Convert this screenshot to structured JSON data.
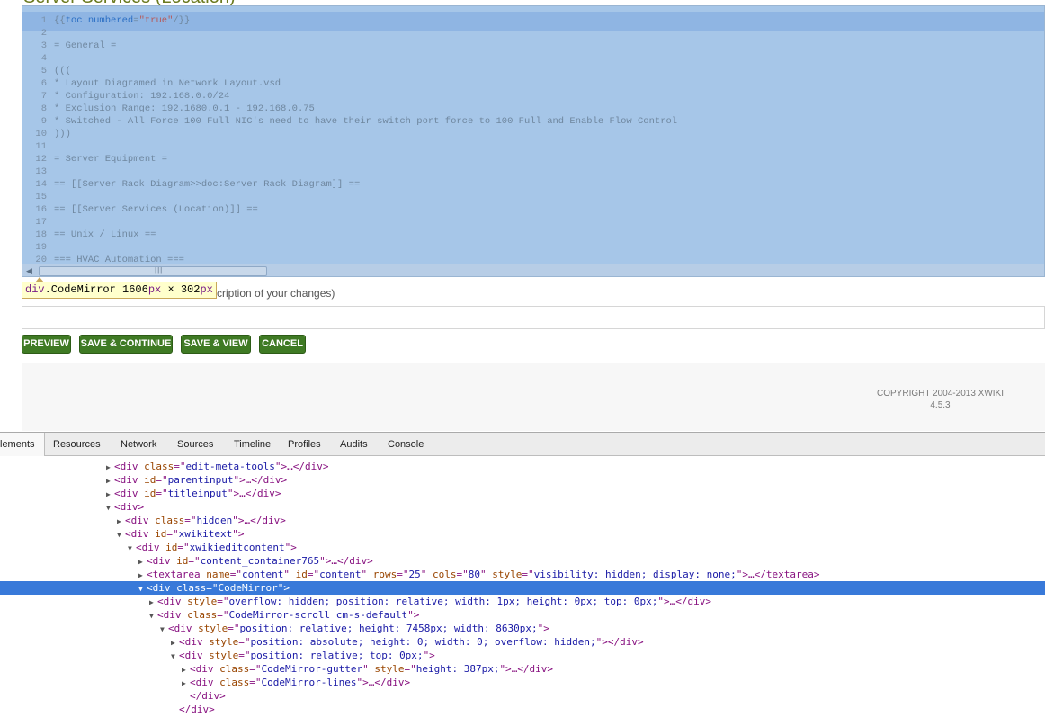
{
  "page": {
    "title": "Server Services (Location)"
  },
  "editor": {
    "lines": [
      {
        "n": "1",
        "text": "{{toc numbered=\"true\"/}}"
      },
      {
        "n": "2",
        "text": ""
      },
      {
        "n": "3",
        "text": "= General ="
      },
      {
        "n": "4",
        "text": ""
      },
      {
        "n": "5",
        "text": "((("
      },
      {
        "n": "6",
        "text": "* Layout Diagramed in Network Layout.vsd"
      },
      {
        "n": "7",
        "text": "* Configuration: 192.168.0.0/24"
      },
      {
        "n": "8",
        "text": "* Exclusion Range: 192.1680.0.1 - 192.168.0.75"
      },
      {
        "n": "9",
        "text": "* Switched - All Force 100 Full NIC's need to have their switch port force to 100 Full and Enable Flow Control"
      },
      {
        "n": "10",
        "text": ")))"
      },
      {
        "n": "11",
        "text": ""
      },
      {
        "n": "12",
        "text": "= Server Equipment ="
      },
      {
        "n": "13",
        "text": ""
      },
      {
        "n": "14",
        "text": "== [[Server Rack Diagram>>doc:Server Rack Diagram]] =="
      },
      {
        "n": "15",
        "text": ""
      },
      {
        "n": "16",
        "text": "== [[Server Services (Location)]] =="
      },
      {
        "n": "17",
        "text": ""
      },
      {
        "n": "18",
        "text": "== Unix / Linux =="
      },
      {
        "n": "19",
        "text": ""
      },
      {
        "n": "20",
        "text": "=== HVAC Automation ==="
      }
    ],
    "first_line": {
      "open": "{{",
      "macro": "toc",
      "param": "numbered",
      "eq": "=",
      "value": "\"true\"",
      "close": "/}}"
    }
  },
  "inspector_tip": {
    "tag": "div",
    "cls": ".CodeMirror",
    "w": "1606",
    "unit1": "px",
    "x": " × ",
    "h": "302",
    "unit2": "px"
  },
  "summary": {
    "label": "cription of your changes)",
    "value": ""
  },
  "buttons": {
    "preview": "PREVIEW",
    "save_continue": "SAVE & CONTINUE",
    "save_view": "SAVE & VIEW",
    "cancel": "CANCEL"
  },
  "footer": {
    "line1": "COPYRIGHT 2004-2013 XWIKI",
    "line2": "4.5.3"
  },
  "devtools": {
    "tabs": {
      "elements": "lements",
      "resources": "Resources",
      "network": "Network",
      "sources": "Sources",
      "timeline": "Timeline",
      "profiles": "Profiles",
      "audits": "Audits",
      "console": "Console"
    },
    "nodes": [
      {
        "pad": 118,
        "tw": "▶",
        "parts": [
          [
            "t",
            "<div "
          ],
          [
            "a",
            "class"
          ],
          [
            "t",
            "=\""
          ],
          [
            "v",
            "edit-meta-tools"
          ],
          [
            "t",
            "\">"
          ],
          [
            "p",
            "…"
          ],
          [
            "t",
            "</div>"
          ]
        ]
      },
      {
        "pad": 118,
        "tw": "▶",
        "parts": [
          [
            "t",
            "<div "
          ],
          [
            "a",
            "id"
          ],
          [
            "t",
            "=\""
          ],
          [
            "v",
            "parentinput"
          ],
          [
            "t",
            "\">"
          ],
          [
            "p",
            "…"
          ],
          [
            "t",
            "</div>"
          ]
        ]
      },
      {
        "pad": 118,
        "tw": "▶",
        "parts": [
          [
            "t",
            "<div "
          ],
          [
            "a",
            "id"
          ],
          [
            "t",
            "=\""
          ],
          [
            "v",
            "titleinput"
          ],
          [
            "t",
            "\">"
          ],
          [
            "p",
            "…"
          ],
          [
            "t",
            "</div>"
          ]
        ]
      },
      {
        "pad": 118,
        "tw": "▼",
        "parts": [
          [
            "t",
            "<div>"
          ]
        ]
      },
      {
        "pad": 130,
        "tw": "▶",
        "parts": [
          [
            "t",
            "<div "
          ],
          [
            "a",
            "class"
          ],
          [
            "t",
            "=\""
          ],
          [
            "v",
            "hidden"
          ],
          [
            "t",
            "\">"
          ],
          [
            "p",
            "…"
          ],
          [
            "t",
            "</div>"
          ]
        ]
      },
      {
        "pad": 130,
        "tw": "▼",
        "parts": [
          [
            "t",
            "<div "
          ],
          [
            "a",
            "id"
          ],
          [
            "t",
            "=\""
          ],
          [
            "v",
            "xwikitext"
          ],
          [
            "t",
            "\">"
          ]
        ]
      },
      {
        "pad": 142,
        "tw": "▼",
        "parts": [
          [
            "t",
            "<div "
          ],
          [
            "a",
            "id"
          ],
          [
            "t",
            "=\""
          ],
          [
            "v",
            "xwikieditcontent"
          ],
          [
            "t",
            "\">"
          ]
        ]
      },
      {
        "pad": 154,
        "tw": "▶",
        "parts": [
          [
            "t",
            "<div "
          ],
          [
            "a",
            "id"
          ],
          [
            "t",
            "=\""
          ],
          [
            "v",
            "content_container765"
          ],
          [
            "t",
            "\">"
          ],
          [
            "p",
            "…"
          ],
          [
            "t",
            "</div>"
          ]
        ]
      },
      {
        "pad": 154,
        "tw": "▶",
        "parts": [
          [
            "t",
            "<textarea "
          ],
          [
            "a",
            "name"
          ],
          [
            "t",
            "=\""
          ],
          [
            "v",
            "content"
          ],
          [
            "t",
            "\" "
          ],
          [
            "a",
            "id"
          ],
          [
            "t",
            "=\""
          ],
          [
            "v",
            "content"
          ],
          [
            "t",
            "\" "
          ],
          [
            "a",
            "rows"
          ],
          [
            "t",
            "=\""
          ],
          [
            "v",
            "25"
          ],
          [
            "t",
            "\" "
          ],
          [
            "a",
            "cols"
          ],
          [
            "t",
            "=\""
          ],
          [
            "v",
            "80"
          ],
          [
            "t",
            "\" "
          ],
          [
            "a",
            "style"
          ],
          [
            "t",
            "=\""
          ],
          [
            "v",
            "visibility: hidden; display: none;"
          ],
          [
            "t",
            "\">"
          ],
          [
            "p",
            "…"
          ],
          [
            "t",
            "</textarea>"
          ]
        ]
      },
      {
        "pad": 154,
        "tw": "▼",
        "sel": true,
        "parts": [
          [
            "t",
            "<div "
          ],
          [
            "a",
            "class"
          ],
          [
            "t",
            "=\""
          ],
          [
            "v",
            "CodeMirror"
          ],
          [
            "t",
            "\">"
          ]
        ]
      },
      {
        "pad": 166,
        "tw": "▶",
        "parts": [
          [
            "t",
            "<div "
          ],
          [
            "a",
            "style"
          ],
          [
            "t",
            "=\""
          ],
          [
            "v",
            "overflow: hidden; position: relative; width: 1px; height: 0px; top: 0px;"
          ],
          [
            "t",
            "\">"
          ],
          [
            "p",
            "…"
          ],
          [
            "t",
            "</div>"
          ]
        ]
      },
      {
        "pad": 166,
        "tw": "▼",
        "parts": [
          [
            "t",
            "<div "
          ],
          [
            "a",
            "class"
          ],
          [
            "t",
            "=\""
          ],
          [
            "v",
            "CodeMirror-scroll cm-s-default"
          ],
          [
            "t",
            "\">"
          ]
        ]
      },
      {
        "pad": 178,
        "tw": "▼",
        "parts": [
          [
            "t",
            "<div "
          ],
          [
            "a",
            "style"
          ],
          [
            "t",
            "=\""
          ],
          [
            "v",
            "position: relative; height: 7458px; width: 8630px;"
          ],
          [
            "t",
            "\">"
          ]
        ]
      },
      {
        "pad": 190,
        "tw": "▶",
        "parts": [
          [
            "t",
            "<div "
          ],
          [
            "a",
            "style"
          ],
          [
            "t",
            "=\""
          ],
          [
            "v",
            "position: absolute; height: 0; width: 0; overflow: hidden;"
          ],
          [
            "t",
            "\">"
          ],
          [
            "t",
            "</div>"
          ]
        ]
      },
      {
        "pad": 190,
        "tw": "▼",
        "parts": [
          [
            "t",
            "<div "
          ],
          [
            "a",
            "style"
          ],
          [
            "t",
            "=\""
          ],
          [
            "v",
            "position: relative; top: 0px;"
          ],
          [
            "t",
            "\">"
          ]
        ]
      },
      {
        "pad": 202,
        "tw": "▶",
        "parts": [
          [
            "t",
            "<div "
          ],
          [
            "a",
            "class"
          ],
          [
            "t",
            "=\""
          ],
          [
            "v",
            "CodeMirror-gutter"
          ],
          [
            "t",
            "\" "
          ],
          [
            "a",
            "style"
          ],
          [
            "t",
            "=\""
          ],
          [
            "v",
            "height: 387px;"
          ],
          [
            "t",
            "\">"
          ],
          [
            "p",
            "…"
          ],
          [
            "t",
            "</div>"
          ]
        ]
      },
      {
        "pad": 202,
        "tw": "▶",
        "parts": [
          [
            "t",
            "<div "
          ],
          [
            "a",
            "class"
          ],
          [
            "t",
            "=\""
          ],
          [
            "v",
            "CodeMirror-lines"
          ],
          [
            "t",
            "\">"
          ],
          [
            "p",
            "…"
          ],
          [
            "t",
            "</div>"
          ]
        ]
      },
      {
        "pad": 202,
        "tw": "",
        "parts": [
          [
            "t",
            "</div>"
          ]
        ]
      },
      {
        "pad": 190,
        "tw": "",
        "parts": [
          [
            "t",
            "</div>"
          ]
        ]
      }
    ]
  }
}
